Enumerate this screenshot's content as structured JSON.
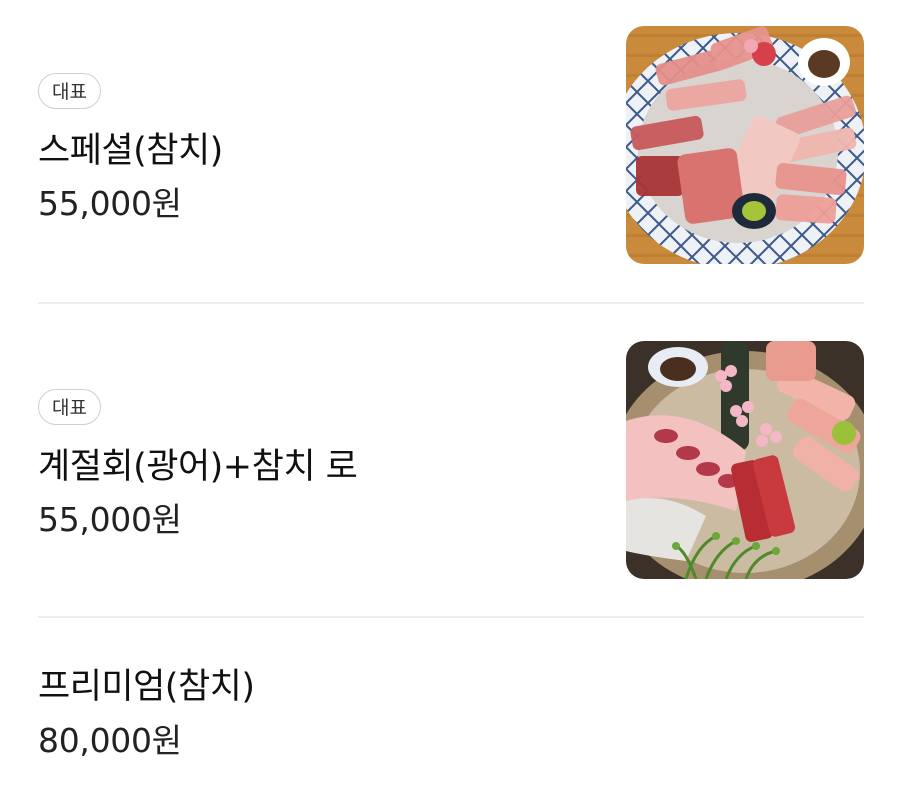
{
  "menu": {
    "items": [
      {
        "badge": "대표",
        "name": "스페셜(참치)",
        "price": "55,000원",
        "image": "tuna-sashimi-platter-photo"
      },
      {
        "badge": "대표",
        "name": "계절회(광어)+참치 로",
        "price": "55,000원",
        "image": "flatfish-and-tuna-sashimi-platter-photo"
      },
      {
        "name": "프리미엄(참치)",
        "price": "80,000원"
      }
    ]
  }
}
